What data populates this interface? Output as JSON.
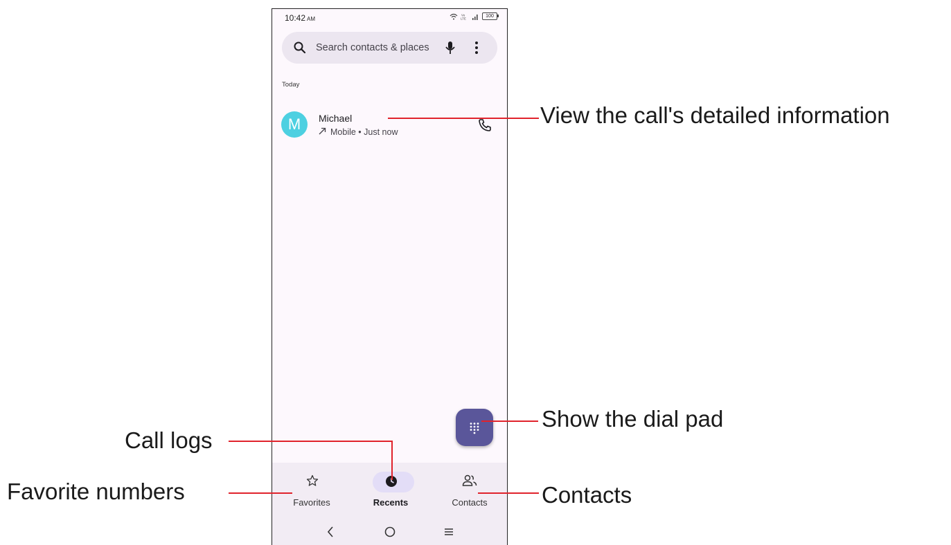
{
  "status_bar": {
    "time": "10:42",
    "ampm": "AM",
    "battery": "100"
  },
  "search": {
    "placeholder": "Search contacts & places"
  },
  "section": {
    "label": "Today"
  },
  "call": {
    "avatar_letter": "M",
    "name": "Michael",
    "detail": "Mobile • Just now",
    "direction_icon": "outgoing-arrow-icon"
  },
  "nav": {
    "items": [
      {
        "label": "Favorites",
        "icon": "star-icon"
      },
      {
        "label": "Recents",
        "icon": "clock-icon",
        "active": true
      },
      {
        "label": "Contacts",
        "icon": "people-icon"
      }
    ]
  },
  "callouts": {
    "details": "View the call's detailed information",
    "dialpad": "Show the dial pad",
    "call_logs": "Call logs",
    "favorites": "Favorite numbers",
    "contacts": "Contacts"
  },
  "colors": {
    "accent": "#5a569a",
    "callout": "#e0222b",
    "avatar": "#4dd0e1"
  }
}
